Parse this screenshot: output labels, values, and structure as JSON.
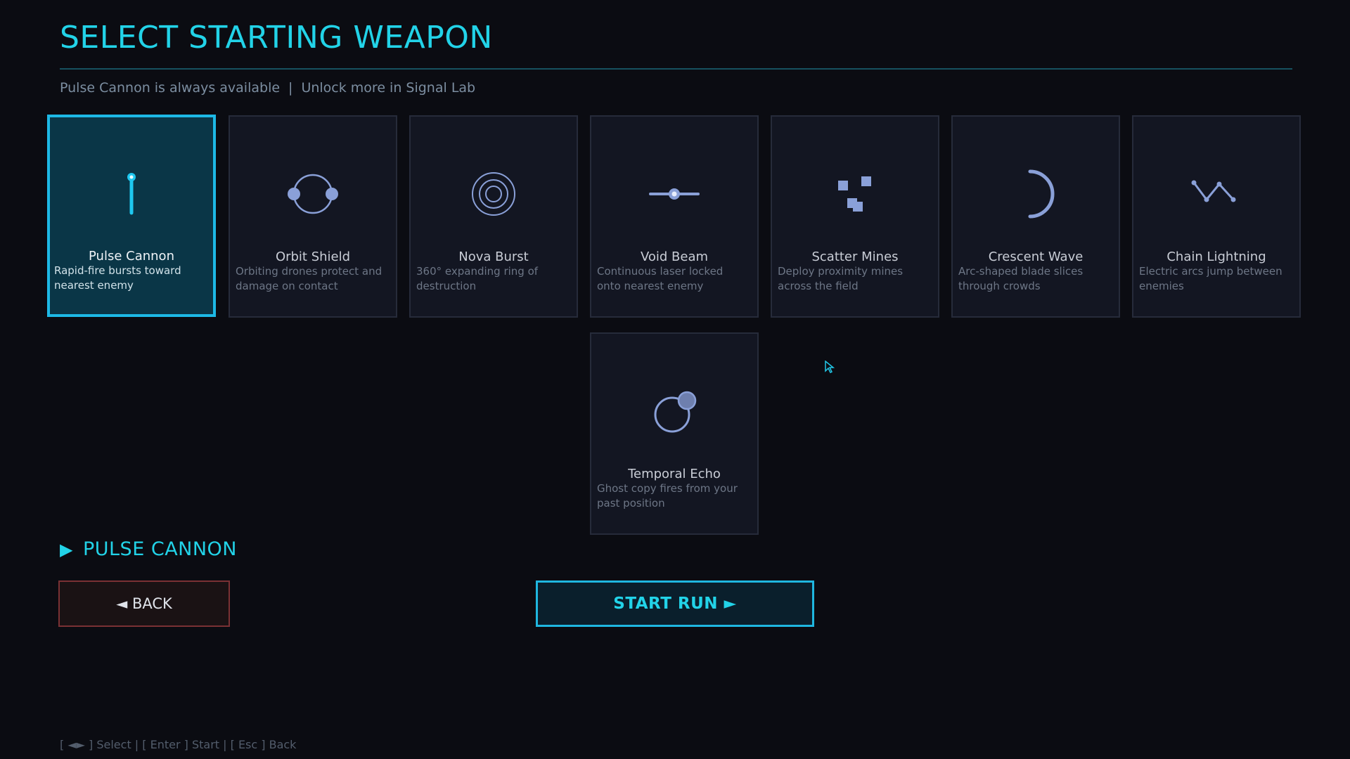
{
  "header": {
    "title": "SELECT STARTING WEAPON",
    "subtitle_left": "Pulse Cannon is always available",
    "subtitle_sep": "|",
    "subtitle_right": "Unlock more in Signal Lab"
  },
  "weapons": [
    {
      "name": "Pulse Cannon",
      "desc": "Rapid-fire bursts toward nearest enemy",
      "icon": "pulse-cannon-icon",
      "selected": true
    },
    {
      "name": "Orbit Shield",
      "desc": "Orbiting drones protect and damage on contact",
      "icon": "orbit-shield-icon",
      "selected": false
    },
    {
      "name": "Nova Burst",
      "desc": "360° expanding ring of destruction",
      "icon": "nova-burst-icon",
      "selected": false
    },
    {
      "name": "Void Beam",
      "desc": "Continuous laser locked onto nearest enemy",
      "icon": "void-beam-icon",
      "selected": false
    },
    {
      "name": "Scatter Mines",
      "desc": "Deploy proximity mines across the field",
      "icon": "scatter-mines-icon",
      "selected": false
    },
    {
      "name": "Crescent Wave",
      "desc": "Arc-shaped blade slices through crowds",
      "icon": "crescent-wave-icon",
      "selected": false
    },
    {
      "name": "Chain Lightning",
      "desc": "Electric arcs jump between enemies",
      "icon": "chain-lightning-icon",
      "selected": false
    },
    {
      "name": "Temporal Echo",
      "desc": "Ghost copy fires from your past position",
      "icon": "temporal-echo-icon",
      "selected": false
    }
  ],
  "selection": {
    "arrow": "▶",
    "label": "PULSE CANNON"
  },
  "buttons": {
    "back": "◄ BACK",
    "start": "START RUN ►"
  },
  "hints": "[ ◄► ] Select  |  [ Enter ] Start  |  [ Esc ] Back",
  "colors": {
    "accent": "#22d3e8",
    "background": "#0b0c12",
    "card": "#131622",
    "selected_card": "#0a3647",
    "back_border": "#7a3134",
    "icon": "#8aa0d8"
  }
}
